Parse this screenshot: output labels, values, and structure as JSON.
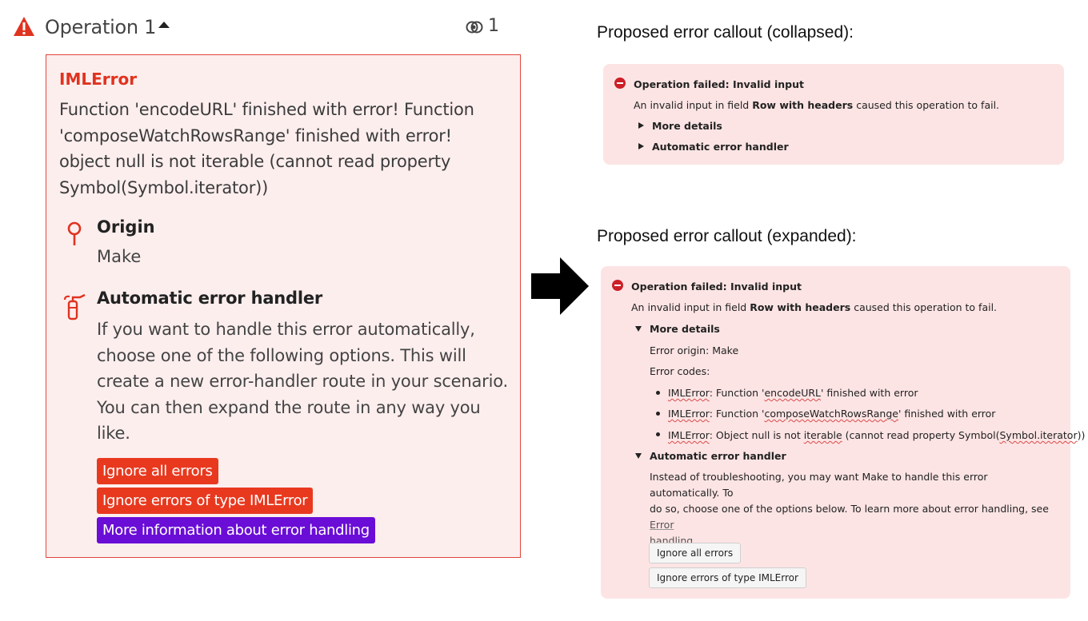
{
  "left": {
    "header": {
      "title": "Operation 1",
      "bundle_count": "1"
    },
    "error": {
      "type": "IMLError",
      "message": "Function 'encodeURL' finished with error! Function 'composeWatchRowsRange' finished with error! object null is not iterable (cannot read property Symbol(Symbol.iterator))",
      "origin_title": "Origin",
      "origin_value": "Make",
      "handler_title": "Automatic error handler",
      "handler_desc": "If you want to handle this error automatically, choose one of the following options. This will create a new error-handler route in your scenario. You can then expand the route in any way you like.",
      "buttons": {
        "ignore_all": "Ignore all errors",
        "ignore_type": "Ignore errors of type IMLError",
        "more_info": "More information about error handling"
      }
    },
    "colors": {
      "error_red": "#e8391f",
      "purple": "#6a0dd6",
      "box_bg": "#fdeeee"
    }
  },
  "right": {
    "collapsed_heading": "Proposed error callout (collapsed):",
    "expanded_heading": "Proposed error callout (expanded):",
    "callout": {
      "title": "Operation failed: Invalid input",
      "desc_prefix": "An invalid input in field ",
      "desc_field": "Row with headers",
      "desc_suffix": " caused this operation to fail.",
      "more_details": "More details",
      "auto_handler": "Automatic error handler",
      "error_origin": "Error origin: Make",
      "error_codes_label": "Error codes:",
      "codes": [
        {
          "type": "IMLError",
          "pre": ": Function '",
          "fn": "encodeURL",
          "post": "' finished with error"
        },
        {
          "type": "IMLError",
          "pre": ": Function '",
          "fn": "composeWatchRowsRange",
          "post": "' finished with error"
        },
        {
          "type": "IMLError",
          "pre": ": Object null is not ",
          "fn": "iterable",
          "post": " (cannot read property Symbol(",
          "fn2": "Symbol.iterator",
          "post2": "))"
        }
      ],
      "handler_desc_1": "Instead of troubleshooting, you may want Make to handle this error automatically. To",
      "handler_desc_2": "do so, choose one of the options below. To learn more about error handling, see ",
      "handler_link_1": "Error",
      "handler_link_2": "handling",
      "handler_desc_end": ".",
      "btn_ignore_all": "Ignore all errors",
      "btn_ignore_type": "Ignore errors of type IMLError"
    },
    "colors": {
      "callout_bg": "#fde4e4",
      "stop_icon": "#cc1f27"
    }
  },
  "icons": [
    "warning-icon",
    "caret-up-icon",
    "bundle-icon",
    "origin-pin-icon",
    "fire-extinguisher-icon",
    "right-arrow-icon",
    "stop-icon",
    "disclosure-triangle-icon"
  ]
}
